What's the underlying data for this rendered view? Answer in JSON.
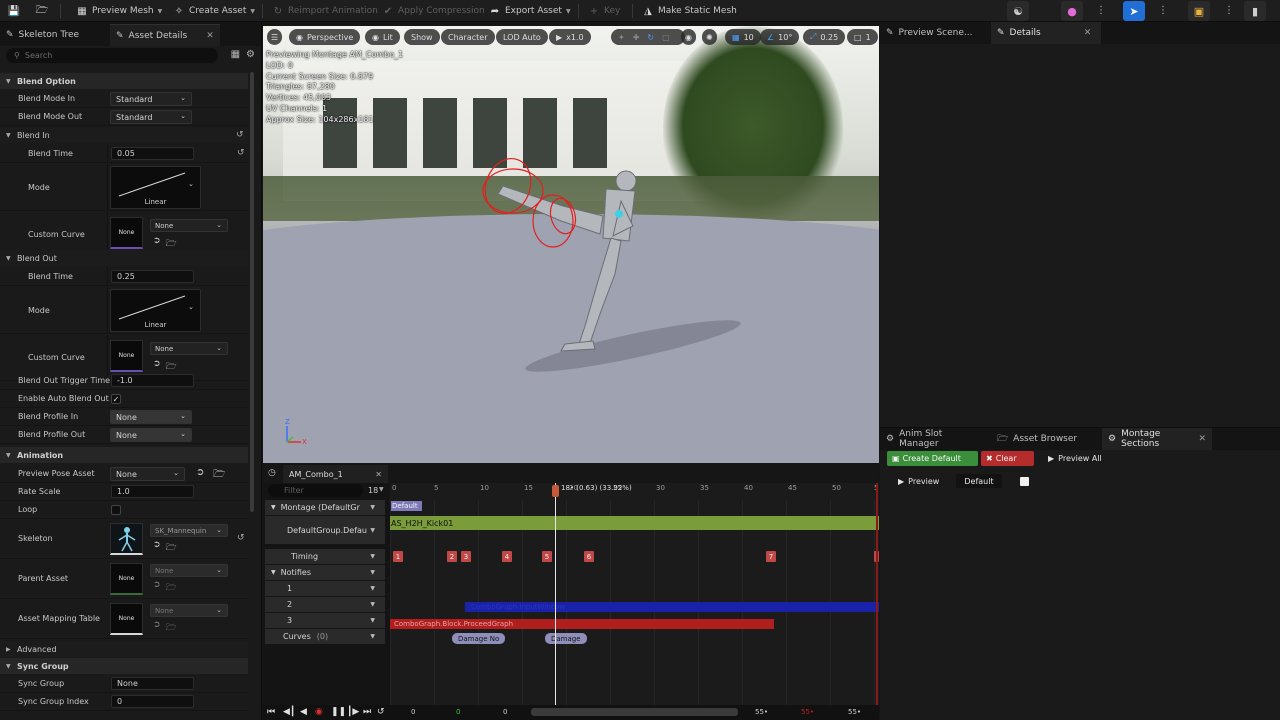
{
  "toolbar": {
    "preview_mesh": "Preview Mesh",
    "create_asset": "Create Asset",
    "reimport": "Reimport Animation",
    "apply_compression": "Apply Compression",
    "export_asset": "Export Asset",
    "key": "Key",
    "make_static_mesh": "Make Static Mesh"
  },
  "left_panel": {
    "tabs": [
      "Skeleton Tree",
      "Asset Details"
    ],
    "search_placeholder": "Search",
    "blend_option": {
      "title": "Blend Option",
      "blend_mode_in_label": "Blend Mode In",
      "blend_mode_in": "Standard",
      "blend_mode_out_label": "Blend Mode Out",
      "blend_mode_out": "Standard"
    },
    "blend_in": {
      "title": "Blend In",
      "blend_time_label": "Blend Time",
      "blend_time": "0.05",
      "mode_label": "Mode",
      "mode": "Linear",
      "custom_curve_label": "Custom Curve",
      "custom_curve_thumb": "None",
      "custom_curve": "None"
    },
    "blend_out": {
      "title": "Blend Out",
      "blend_time_label": "Blend Time",
      "blend_time": "0.25",
      "mode_label": "Mode",
      "mode": "Linear",
      "custom_curve_label": "Custom Curve",
      "custom_curve_thumb": "None",
      "custom_curve": "None"
    },
    "misc": {
      "trigger_time_label": "Blend Out Trigger Time",
      "trigger_time": "-1.0",
      "auto_blend_out_label": "Enable Auto Blend Out",
      "profile_in_label": "Blend Profile In",
      "profile_in": "None",
      "profile_out_label": "Blend Profile Out",
      "profile_out": "None"
    },
    "animation": {
      "title": "Animation",
      "preview_pose_label": "Preview Pose Asset",
      "preview_pose": "None",
      "rate_scale_label": "Rate Scale",
      "rate_scale": "1.0",
      "loop_label": "Loop",
      "skeleton_label": "Skeleton",
      "skeleton": "SK_Mannequin",
      "parent_asset_label": "Parent Asset",
      "parent_thumb": "None",
      "parent_asset": "None",
      "mapping_label": "Asset Mapping Table",
      "mapping_thumb": "None",
      "mapping_asset": "None"
    },
    "advanced": "Advanced",
    "sync_group": {
      "title": "Sync Group",
      "sync_group_label": "Sync Group",
      "sync_group": "None",
      "sync_index_label": "Sync Group Index",
      "sync_index": "0"
    }
  },
  "viewport": {
    "perspective": "Perspective",
    "lit": "Lit",
    "show": "Show",
    "character": "Character",
    "lod": "LOD Auto",
    "speed": "x1.0",
    "grid": "10",
    "angle": "10°",
    "scale": "0.25",
    "camera": "1",
    "info": [
      "Previewing Montage AM_Combo_1",
      "LOD: 0",
      "Current Screen Size: 0.879",
      "Triangles: 87,280",
      "Vertices: 45,003",
      "UV Channels: 1",
      "Approx Size: 104x286x181"
    ],
    "axis_z": "Z",
    "axis_x": "X"
  },
  "right_top": {
    "tabs": [
      "Preview Scene...",
      "Details"
    ]
  },
  "right_bottom": {
    "tabs": [
      "Anim Slot Manager",
      "Asset Browser",
      "Montage Sections"
    ],
    "create_default": "Create Default",
    "clear": "Clear",
    "preview_all": "Preview All",
    "preview": "Preview",
    "default_section": "Default"
  },
  "timeline": {
    "tab": "AM_Combo_1",
    "filter_placeholder": "Filter",
    "frame_count": "18",
    "playhead_label": "18• (0.63) (33.92%)",
    "ticks": [
      "0",
      "5",
      "10",
      "15",
      "20",
      "25",
      "30",
      "35",
      "40",
      "45",
      "50",
      "5"
    ],
    "tracks": {
      "montage": "Montage (DefaultGr",
      "slot": "DefaultGroup.Defau",
      "timing": "Timing",
      "notifies": "Notifies",
      "n1": "1",
      "n2": "2",
      "n3": "3",
      "curves": "Curves",
      "curves_count": "(0)"
    },
    "section_default": "Default",
    "segment": "AS_H2H_Kick01",
    "markers": [
      "1",
      "2",
      "3",
      "4",
      "5",
      "6",
      "7"
    ],
    "notify_window": "ComboGraph.InputWindow",
    "notify_block": "ComboGraph.Block.ProceedGraph",
    "notify_damage1": "Damage No",
    "notify_damage2": "Damage",
    "bottom_nums": [
      "0",
      "0",
      "0",
      "55•",
      "55•",
      "55•"
    ]
  },
  "colors": {
    "green": "#7a9c3a",
    "blue": "#1a22a8",
    "red": "#b01e1e",
    "marker": "#c24848",
    "accent_blue": "#1f6fd6"
  }
}
